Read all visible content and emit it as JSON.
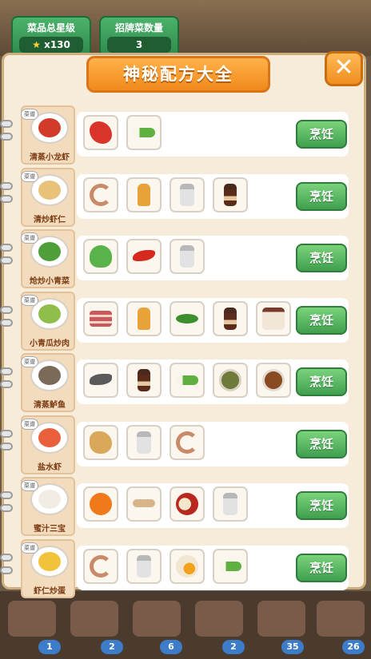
{
  "stats": {
    "total_stars_label": "菜品总星级",
    "total_stars_value": "x130",
    "signature_label": "招牌菜数量",
    "signature_value": "3"
  },
  "panel": {
    "title": "神秘配方大全",
    "close_label": "✕"
  },
  "tag_label": "菜谱",
  "cook_label": "烹饪",
  "recipes": [
    {
      "name": "清蒸小龙虾",
      "food_color": "#d23a2a",
      "ingredients": [
        "crayfish-icon",
        "scallion-icon"
      ]
    },
    {
      "name": "清炒虾仁",
      "food_color": "#e8c27a",
      "ingredients": [
        "shrimp-icon",
        "oil-bottle-icon",
        "salt-shaker-icon",
        "soy-sauce-icon"
      ]
    },
    {
      "name": "炝炒小青菜",
      "food_color": "#4f9e3a",
      "ingredients": [
        "bok-choy-icon",
        "chili-icon",
        "salt-shaker-icon"
      ]
    },
    {
      "name": "小青瓜炒肉",
      "food_color": "#8fbf4a",
      "ingredients": [
        "pork-belly-icon",
        "oil-bottle-icon",
        "cucumber-icon",
        "soy-sauce-icon",
        "seasoning-jar-icon"
      ]
    },
    {
      "name": "清蒸鲈鱼",
      "food_color": "#7a6a58",
      "ingredients": [
        "fish-icon",
        "soy-sauce-icon",
        "scallion-icon",
        "pepper-bowl-icon",
        "spice-bowl-icon"
      ]
    },
    {
      "name": "盐水虾",
      "food_color": "#e8603c",
      "ingredients": [
        "ginger-icon",
        "salt-shaker-icon",
        "shrimp-icon"
      ]
    },
    {
      "name": "蜜汁三宝",
      "food_color": "#f2ede4",
      "ingredients": [
        "pumpkin-icon",
        "yam-icon",
        "date-icon",
        "salt-shaker-icon"
      ]
    },
    {
      "name": "虾仁炒蛋",
      "food_color": "#f2c23a",
      "ingredients": [
        "shrimp-icon",
        "salt-shaker-icon",
        "egg-icon",
        "scallion-icon"
      ]
    }
  ],
  "shelf_counts": [
    "1",
    "2",
    "6",
    "2",
    "35",
    "26"
  ],
  "colors": {
    "accent_orange": "#f08a1a",
    "cook_green": "#3f9f4f",
    "panel_bg": "#f7ecd9"
  }
}
